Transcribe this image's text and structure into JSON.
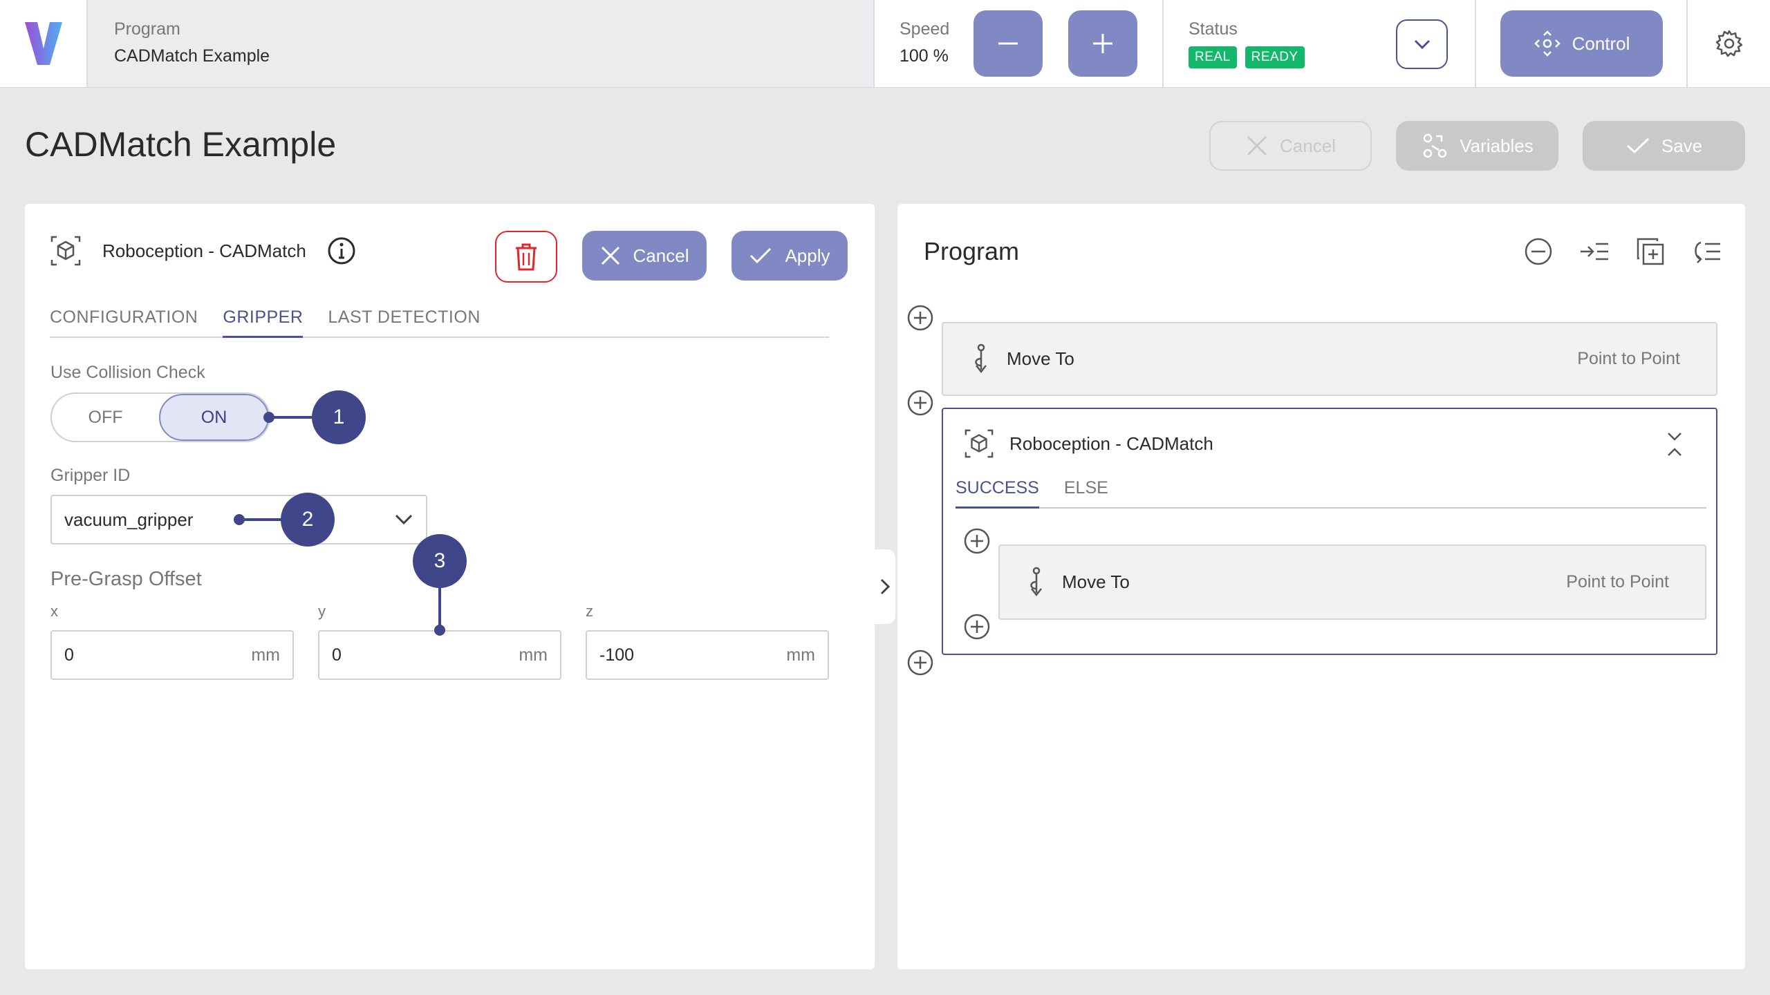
{
  "topbar": {
    "program_label": "Program",
    "program_name": "CADMatch Example",
    "speed_label": "Speed",
    "speed_value": "100 %",
    "status_label": "Status",
    "status_badges": [
      "REAL",
      "READY"
    ],
    "control_label": "Control"
  },
  "page": {
    "title": "CADMatch Example",
    "cancel_label": "Cancel",
    "variables_label": "Variables",
    "save_label": "Save"
  },
  "node_editor": {
    "title": "Roboception - CADMatch",
    "cancel_label": "Cancel",
    "apply_label": "Apply",
    "tabs": [
      "CONFIGURATION",
      "GRIPPER",
      "LAST DETECTION"
    ],
    "active_tab": "GRIPPER",
    "collision_label": "Use Collision Check",
    "toggle_off": "OFF",
    "toggle_on": "ON",
    "gripper_id_label": "Gripper ID",
    "gripper_id_value": "vacuum_gripper",
    "pregrasp_label": "Pre-Grasp Offset",
    "offset_fields": [
      {
        "label": "x",
        "value": "0",
        "unit": "mm"
      },
      {
        "label": "y",
        "value": "0",
        "unit": "mm"
      },
      {
        "label": "z",
        "value": "-100",
        "unit": "mm"
      }
    ]
  },
  "annotations": [
    "1",
    "2",
    "3"
  ],
  "program": {
    "title": "Program",
    "steps": [
      {
        "name": "Move To",
        "mode": "Point to Point"
      }
    ],
    "container": {
      "name": "Roboception - CADMatch",
      "tabs": [
        "SUCCESS",
        "ELSE"
      ],
      "active_tab": "SUCCESS",
      "steps": [
        {
          "name": "Move To",
          "mode": "Point to Point"
        }
      ]
    }
  },
  "colors": {
    "accent": "#8089c4",
    "accent_dark": "#3f478a",
    "ready_green": "#14b86b",
    "delete_red": "#e0262c"
  }
}
